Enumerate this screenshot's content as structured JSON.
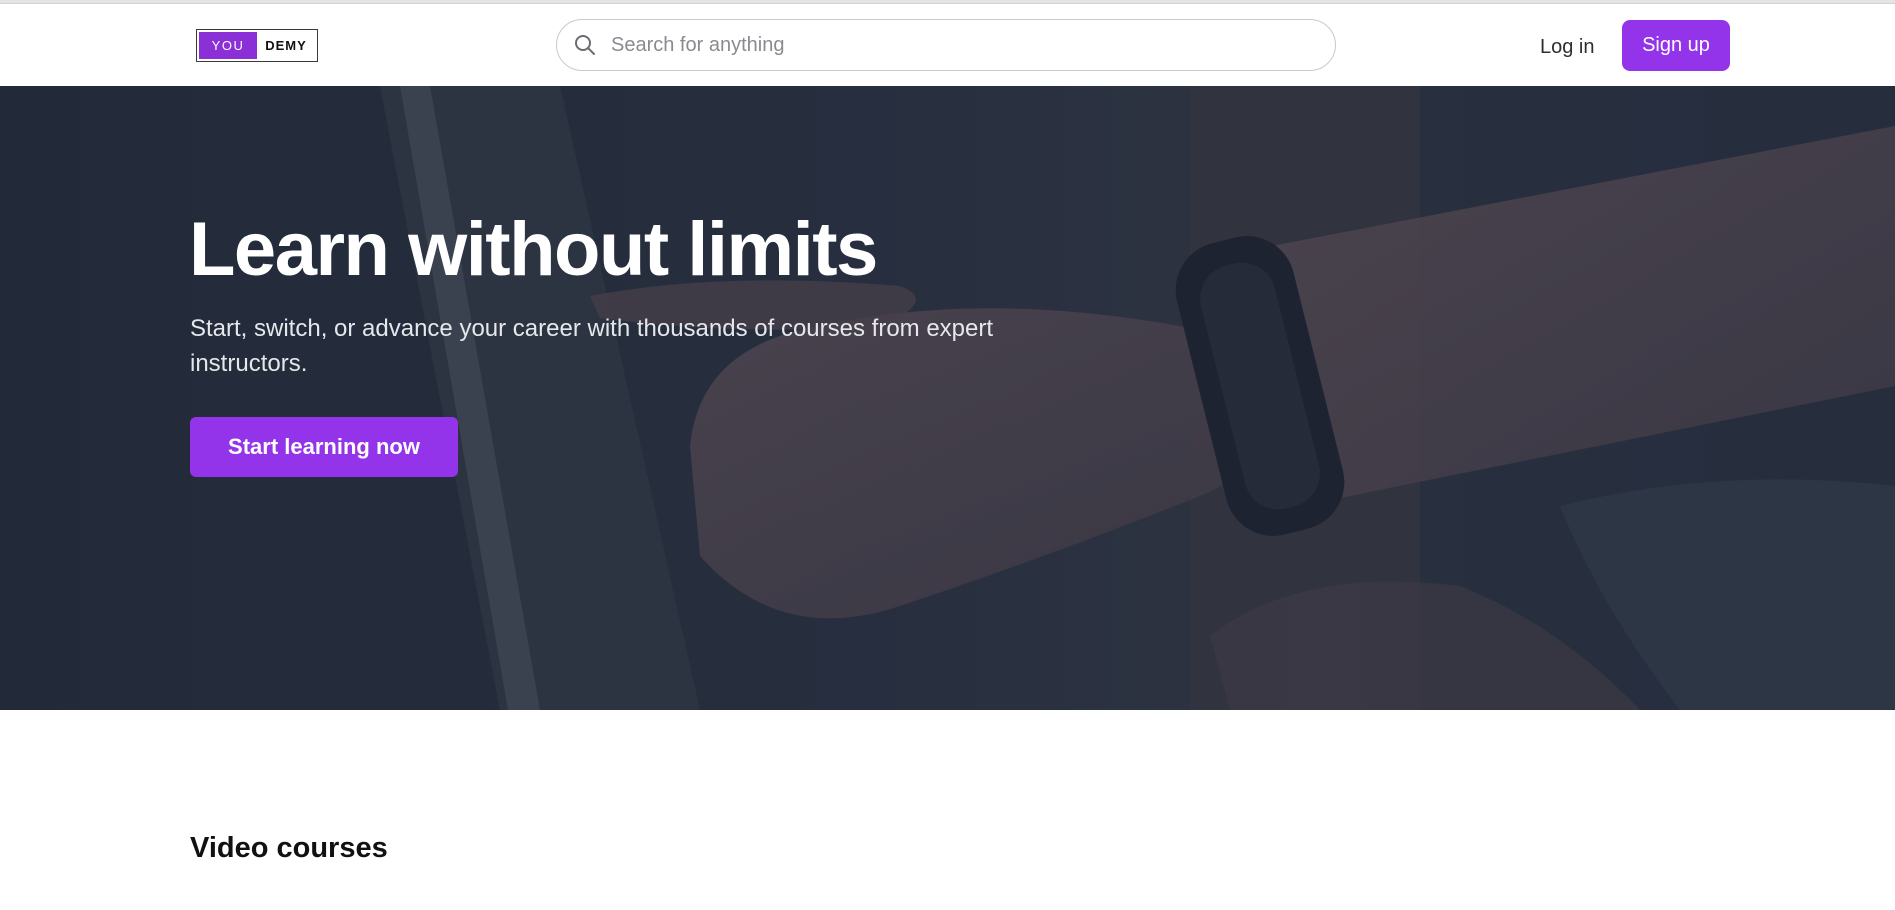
{
  "brand": {
    "logo_left": "YOU",
    "logo_right": "DEMY"
  },
  "search": {
    "placeholder": "Search for anything",
    "value": ""
  },
  "nav": {
    "login_label": "Log in",
    "signup_label": "Sign up"
  },
  "hero": {
    "title": "Learn without limits",
    "subtitle": "Start, switch, or advance your career with thousands of courses from expert instructors.",
    "cta_label": "Start learning now"
  },
  "sections": {
    "video_courses_title": "Video courses"
  },
  "colors": {
    "accent": "#9333ea",
    "logo_purple": "#8b2fd6",
    "hero_overlay": "#283041",
    "text_dark": "#1c1d1f"
  },
  "icons": {
    "search": "search-icon"
  }
}
